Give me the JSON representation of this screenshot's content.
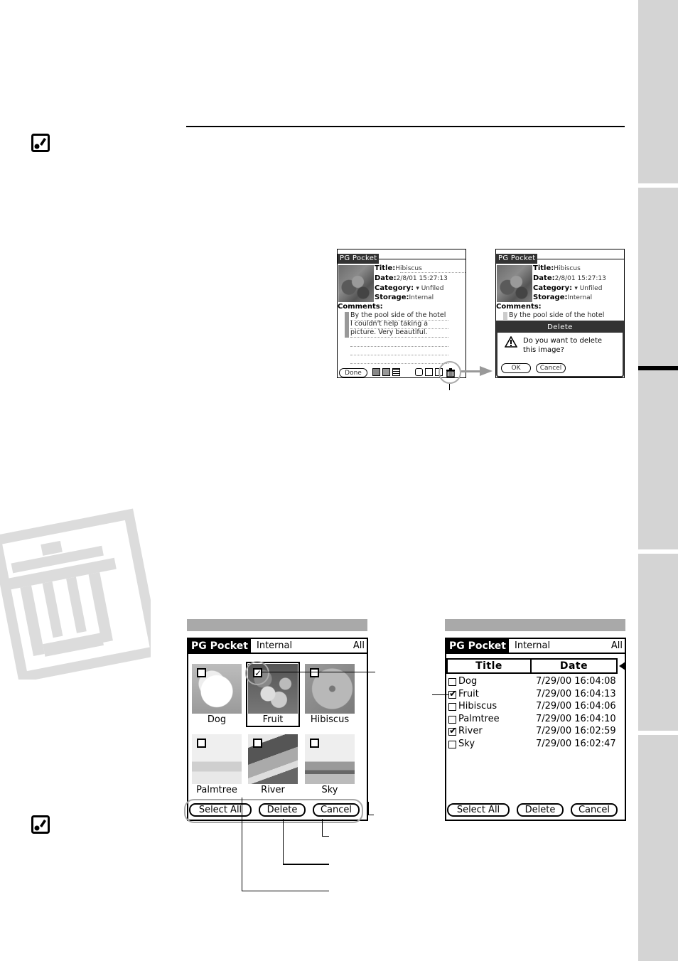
{
  "side_tabs": [
    {
      "id": "tab-1",
      "active": false
    },
    {
      "id": "tab-2",
      "active": true
    },
    {
      "id": "tab-3",
      "active": false
    },
    {
      "id": "tab-4",
      "active": false
    },
    {
      "id": "tab-5",
      "active": false
    }
  ],
  "icons": {
    "note_icon": "note-icon",
    "watermark": "trash-icon",
    "warning": "warning-icon",
    "trash": "trash-icon"
  },
  "detail_screen": {
    "app_title": "PG Pocket",
    "fields": [
      {
        "label": "Title:",
        "value": "Hibiscus"
      },
      {
        "label": "Date:",
        "value": "2/8/01 15:27:13"
      },
      {
        "label": "Category:",
        "value": "▾ Unfiled"
      },
      {
        "label": "Storage:",
        "value": "Internal"
      }
    ],
    "comments_label": "Comments:",
    "comments": [
      "By the pool side of the hotel",
      "I couldn't help taking a",
      "picture. Very beautiful."
    ],
    "done_button": "Done"
  },
  "delete_dialog_screen": {
    "app_title": "PG Pocket",
    "fields": [
      {
        "label": "Title:",
        "value": "Hibiscus"
      },
      {
        "label": "Date:",
        "value": "2/8/01 15:27:13"
      },
      {
        "label": "Category:",
        "value": "▾ Unfiled"
      },
      {
        "label": "Storage:",
        "value": "Internal"
      }
    ],
    "comments_label": "Comments:",
    "comments": [
      "By the pool side of the hotel"
    ],
    "dialog": {
      "title": "Delete",
      "message_line1": "Do you want to delete",
      "message_line2": "this image?",
      "ok": "OK",
      "cancel": "Cancel"
    }
  },
  "thumbnail_screen": {
    "app_title": "PG Pocket",
    "storage": "Internal",
    "category": "All",
    "images": [
      {
        "name": "Dog",
        "checked": false
      },
      {
        "name": "Fruit",
        "checked": true
      },
      {
        "name": "Hibiscus",
        "checked": false
      },
      {
        "name": "Palmtree",
        "checked": false
      },
      {
        "name": "River",
        "checked": false
      },
      {
        "name": "Sky",
        "checked": false
      }
    ],
    "buttons": {
      "select_all": "Select All",
      "delete": "Delete",
      "cancel": "Cancel"
    }
  },
  "list_screen": {
    "app_title": "PG Pocket",
    "storage": "Internal",
    "category": "All",
    "columns": [
      "Title",
      "Date"
    ],
    "rows": [
      {
        "title": "Dog",
        "date": "7/29/00 16:04:08",
        "checked": false
      },
      {
        "title": "Fruit",
        "date": "7/29/00 16:04:13",
        "checked": true
      },
      {
        "title": "Hibiscus",
        "date": "7/29/00 16:04:06",
        "checked": false
      },
      {
        "title": "Palmtree",
        "date": "7/29/00 16:04:10",
        "checked": false
      },
      {
        "title": "River",
        "date": "7/29/00 16:02:59",
        "checked": true
      },
      {
        "title": "Sky",
        "date": "7/29/00 16:02:47",
        "checked": false
      }
    ],
    "buttons": {
      "select_all": "Select All",
      "delete": "Delete",
      "cancel": "Cancel"
    }
  }
}
